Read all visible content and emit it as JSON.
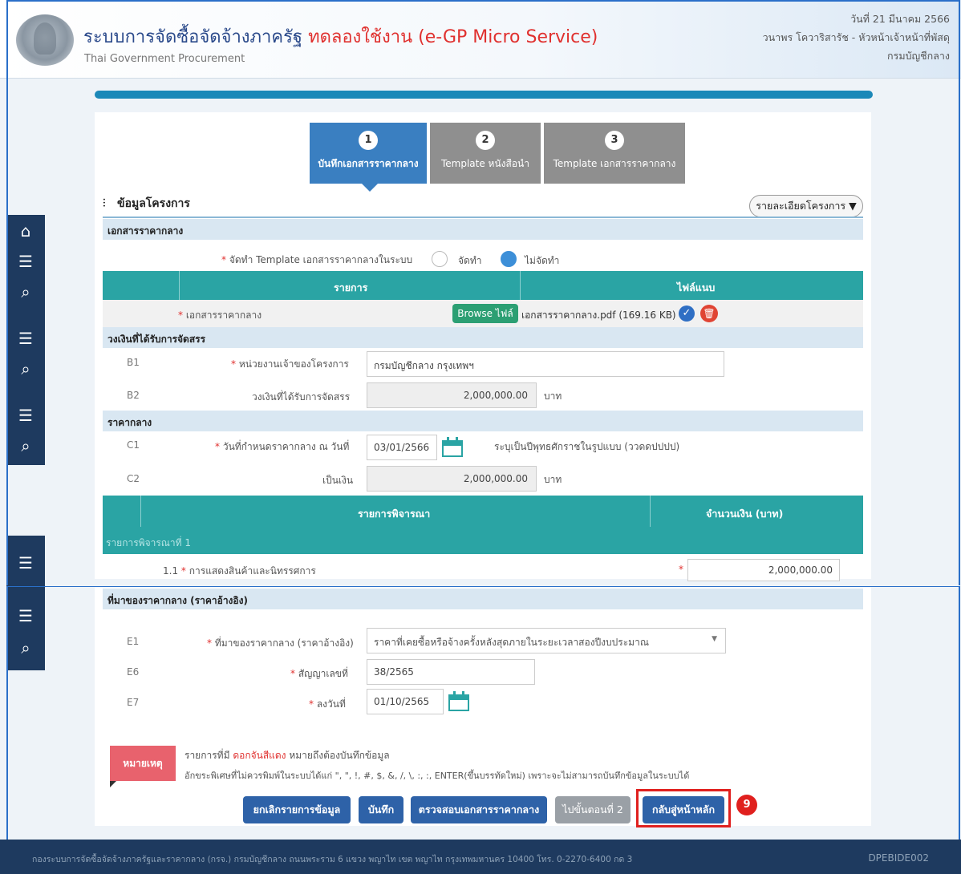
{
  "header": {
    "title_main": "ระบบการจัดซื้อจัดจ้างภาครัฐ",
    "title_trial": "ทดลองใช้งาน (e-GP Micro Service)",
    "subtitle": "Thai Government Procurement",
    "date": "วันที่ 21 มีนาคม 2566",
    "user": "วนาพร โควาริสารัช - หัวหน้าเจ้าหน้าที่พัสดุ",
    "org": "กรมบัญชีกลาง"
  },
  "steps": [
    {
      "num": "1",
      "label": "บันทึกเอกสารราคากลาง"
    },
    {
      "num": "2",
      "label": "Template หนังสือนำ"
    },
    {
      "num": "3",
      "label": "Template เอกสารราคากลาง"
    }
  ],
  "project": {
    "title": "ข้อมูลโครงการ",
    "details_button": "รายละเอียดโครงการ ▼"
  },
  "doc_section": {
    "title": "เอกสารราคากลาง",
    "template_label": "จัดทำ Template เอกสารราคากลางในระบบ",
    "option_yes": "จัดทำ",
    "option_no": "ไม่จัดทำ",
    "col_item": "รายการ",
    "col_attach": "ไฟล์แนบ",
    "row_label": "เอกสารราคากลาง",
    "browse_label": "Browse ไฟล์",
    "file_name": "เอกสารราคากลาง.pdf (169.16 KB)"
  },
  "budget_section": {
    "title": "วงเงินที่ได้รับการจัดสรร",
    "b1_code": "B1",
    "b1_label": "หน่วยงานเจ้าของโครงการ",
    "b1_value": "กรมบัญชีกลาง กรุงเทพฯ",
    "b2_code": "B2",
    "b2_label": "วงเงินที่ได้รับการจัดสรร",
    "b2_value": "2,000,000.00",
    "unit": "บาท"
  },
  "price_section": {
    "title": "ราคากลาง",
    "c1_code": "C1",
    "c1_label": "วันที่กำหนดราคากลาง ณ วันที่",
    "c1_value": "03/01/2566",
    "c1_hint": "ระบุเป็นปีพุทธศักราชในรูปแบบ (ววดดปปปป)",
    "c2_code": "C2",
    "c2_label": "เป็นเงิน",
    "c2_value": "2,000,000.00",
    "unit": "บาท"
  },
  "consider_table": {
    "col_item": "รายการพิจารณา",
    "col_amount": "จำนวนเงิน (บาท)",
    "group_label": "รายการพิจารณาที่ 1",
    "row_no": "1.1",
    "row_label": "การแสดงสินค้าและนิทรรศการ",
    "row_value": "2,000,000.00"
  },
  "source_section": {
    "title": "ที่มาของราคากลาง (ราคาอ้างอิง)",
    "e1_code": "E1",
    "e1_label": "ที่มาของราคากลาง (ราคาอ้างอิง)",
    "e1_value": "ราคาที่เคยซื้อหรือจ้างครั้งหลังสุดภายในระยะเวลาสองปีงบประมาณ",
    "e6_code": "E6",
    "e6_label": "สัญญาเลขที่",
    "e6_value": "38/2565",
    "e7_code": "E7",
    "e7_label": "ลงวันที่",
    "e7_value": "01/10/2565"
  },
  "note": {
    "badge": "หมายเหตุ",
    "line1_prefix": "รายการที่มี",
    "line1_red": "ดอกจันสีแดง",
    "line1_suffix": "หมายถึงต้องบันทึกข้อมูล",
    "line2": "อักขระพิเศษที่ไม่ควรพิมพ์ในระบบได้แก่ \", \", !, #, $, &, /, \\, :, :, ENTER(ขึ้นบรรทัดใหม่) เพราะจะไม่สามารถบันทึกข้อมูลในระบบได้"
  },
  "buttons": {
    "cancel": "ยกเลิกรายการข้อมูล",
    "save": "บันทึก",
    "check": "ตรวจสอบเอกสารราคากลาง",
    "next": "ไปขั้นตอนที่ 2",
    "home": "กลับสู่หน้าหลัก"
  },
  "callout_number": "9",
  "footer": {
    "text": "กองระบบการจัดซื้อจัดจ้างภาครัฐและราคากลาง (กรจ.) กรมบัญชีกลาง ถนนพระราม 6 แขวง พญาไท เขต พญาไท กรุงเทพมหานคร 10400 โทร. 0-2270-6400 กด 3",
    "code": "DPEBIDE002"
  },
  "colors": {
    "primary": "#2e62a8",
    "teal": "#2aa4a4",
    "highlight": "#e0201e",
    "sidebar": "#1e3a5f"
  }
}
